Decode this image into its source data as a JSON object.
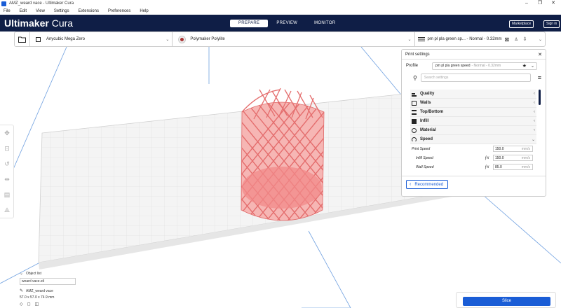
{
  "window": {
    "title": "AMZ_weard vace - Ultimaker Cura",
    "controls": [
      "–",
      "❐",
      "✕"
    ]
  },
  "menu": [
    "File",
    "Edit",
    "View",
    "Settings",
    "Extensions",
    "Preferences",
    "Help"
  ],
  "header": {
    "logo_bold": "Ultimaker",
    "logo_light": " Cura",
    "stages": [
      "PREPARE",
      "PREVIEW",
      "MONITOR"
    ],
    "active_stage": "PREPARE",
    "marketplace": "Marketplace",
    "signin": "Sign in"
  },
  "toolbar": {
    "printer": "Anycubic Mega Zero",
    "material": "Polymaker Polylite",
    "profile_summary": "pm pl pla green sp... - Normal - 0.32mm"
  },
  "print_settings": {
    "title": "Print settings",
    "profile_label": "Profile",
    "profile_value": "pm pl pla green speed",
    "profile_sub": "- Normal - 0.32mm",
    "search_placeholder": "Search settings",
    "categories": [
      "Quality",
      "Walls",
      "Top/Bottom",
      "Infill",
      "Material",
      "Speed"
    ],
    "settings": [
      {
        "label": "Print Speed",
        "value": "150.0",
        "unit": "mm/s",
        "fx": ""
      },
      {
        "label": "Infill Speed",
        "value": "150.0",
        "unit": "mm/s",
        "fx": "ƒx"
      },
      {
        "label": "Wall Speed",
        "value": "85.0",
        "unit": "mm/s",
        "fx": "ƒx"
      }
    ],
    "recommended": "Recommended"
  },
  "object_list": {
    "header": "Object list",
    "file": "weard vace.stl",
    "name": "AMZ_weard vace",
    "dims": "57.0 x 57.0 x 74.9 mm"
  },
  "slice": {
    "label": "Slice"
  },
  "colors": {
    "header": "#0f1e46",
    "accent": "#1a5dd6",
    "model": "#f08c8c"
  }
}
